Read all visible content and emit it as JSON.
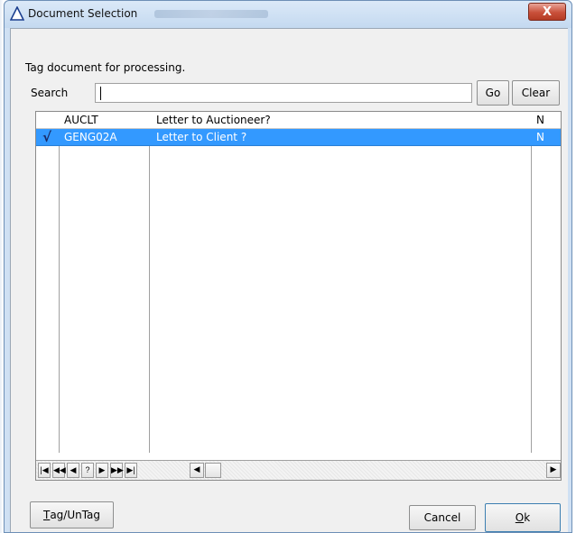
{
  "window": {
    "title": "Document Selection",
    "close_label": "X"
  },
  "form": {
    "heading": "Tag document for processing.",
    "search_label": "Search",
    "search_value": "",
    "go_label": "Go",
    "clear_label": "Clear"
  },
  "grid": {
    "header_row": {
      "code": "AUCLT",
      "description": "Letter to Auctioneer?",
      "flag": "N"
    },
    "rows": [
      {
        "tagged": true,
        "tag_mark": "√",
        "code": "GENG02A",
        "description": "Letter to Client ?",
        "flag": "N",
        "selected": true
      }
    ],
    "navigator": [
      "|◀",
      "◀◀",
      "◀",
      "?",
      "▶",
      "▶▶",
      "▶|"
    ],
    "scroll_left": "◀",
    "scroll_right": "▶"
  },
  "buttons": {
    "tag_untag_mnemonic": "T",
    "tag_untag_rest": "ag/UnTag",
    "cancel_label": "Cancel",
    "ok_mnemonic": "O",
    "ok_rest": "k"
  },
  "colors": {
    "selection": "#3399ff",
    "titlebar": "#cfe0f3",
    "close_button": "#c9503a"
  }
}
